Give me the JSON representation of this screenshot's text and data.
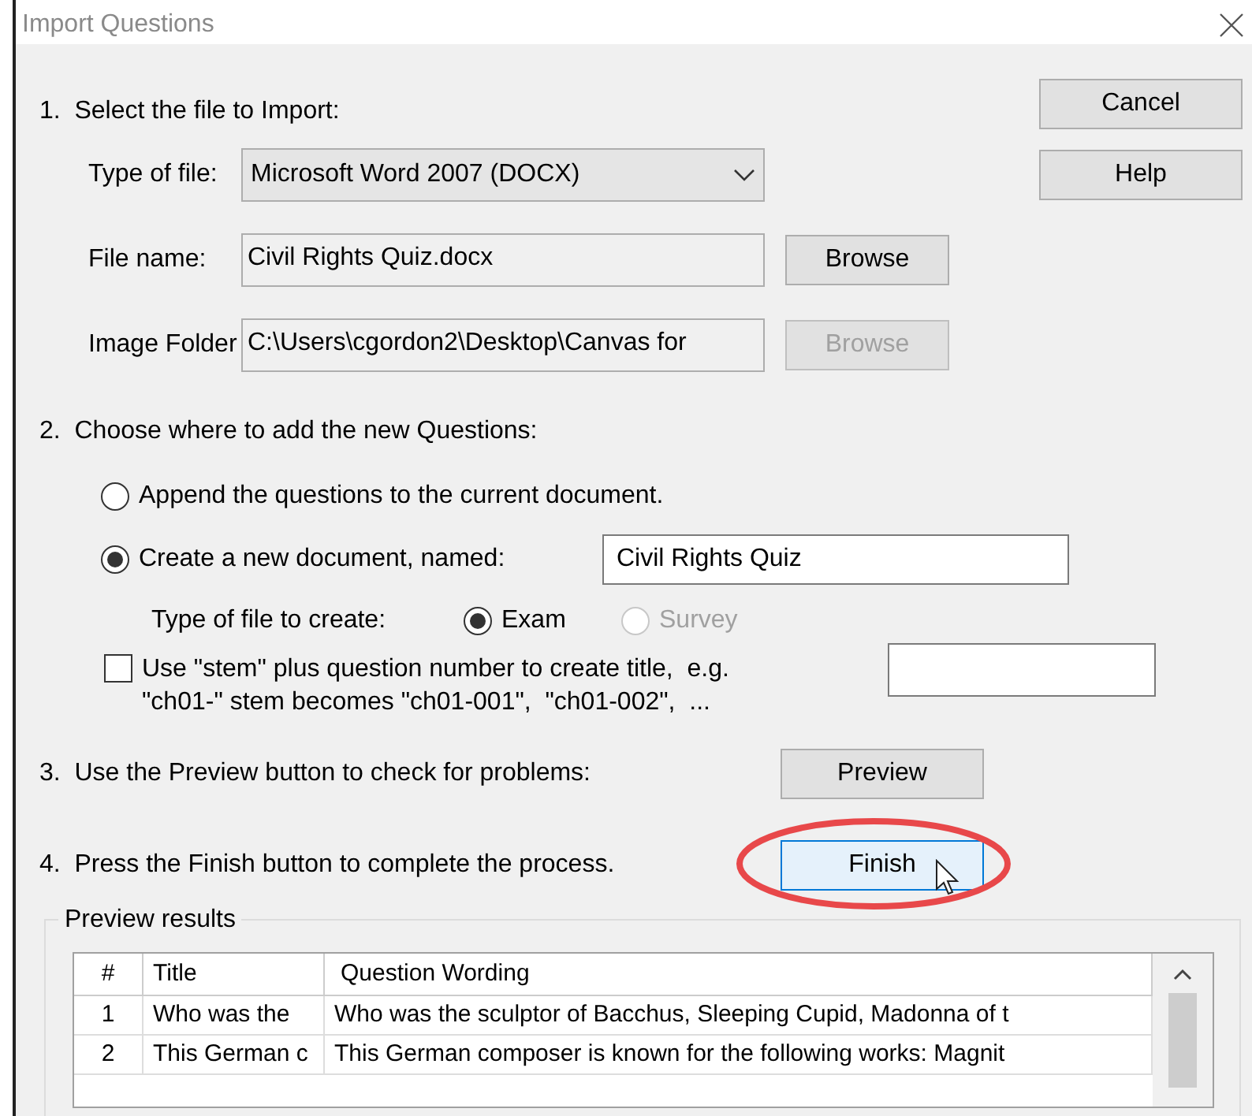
{
  "window": {
    "title": "Import Questions"
  },
  "side_buttons": [
    {
      "label": "Cancel"
    },
    {
      "label": "Help"
    }
  ],
  "step1": {
    "heading": "1.  Select the file to Import:",
    "fields": [
      {
        "kind": "dropdown",
        "label": "Type of file:",
        "value": "Microsoft Word 2007 (DOCX)"
      },
      {
        "kind": "text",
        "label": "File name:",
        "value": "Civil Rights Quiz.docx",
        "button": {
          "label": "Browse",
          "disabled": false
        }
      },
      {
        "kind": "text",
        "label": "Image Folder",
        "value": "C:\\Users\\cgordon2\\Desktop\\Canvas for",
        "button": {
          "label": "Browse",
          "disabled": true
        }
      }
    ]
  },
  "step2": {
    "heading": "2.  Choose where to add the new Questions:",
    "options": [
      {
        "label": "Append the questions to the current document.",
        "selected": false
      },
      {
        "label": "Create a new document, named:",
        "selected": true,
        "value": "Civil Rights Quiz"
      }
    ],
    "file_type": {
      "label": "Type of file to create:",
      "options": [
        {
          "label": "Exam",
          "selected": true,
          "disabled": false
        },
        {
          "label": "Survey",
          "selected": false,
          "disabled": true
        }
      ]
    },
    "stem": {
      "checked": false,
      "label": "Use \"stem\" plus question number to create title,  e.g.\n\"ch01-\" stem becomes \"ch01-001\",  \"ch01-002\",  ..."
    }
  },
  "step3": {
    "text": "3.  Use the Preview button to check for problems:",
    "button": {
      "label": "Preview",
      "highlighted": false
    }
  },
  "step4": {
    "text": "4.  Press the Finish button to complete the process.",
    "button": {
      "label": "Finish",
      "highlighted": true
    }
  },
  "preview": {
    "title": "Preview results",
    "columns": [
      "#",
      "Title",
      "Question Wording"
    ],
    "rows": [
      [
        "1",
        "Who was the",
        "Who was the sculptor of Bacchus, Sleeping Cupid, Madonna of t"
      ],
      [
        "2",
        "This German c",
        "This German composer is known for the following works: Magnit"
      ]
    ]
  }
}
